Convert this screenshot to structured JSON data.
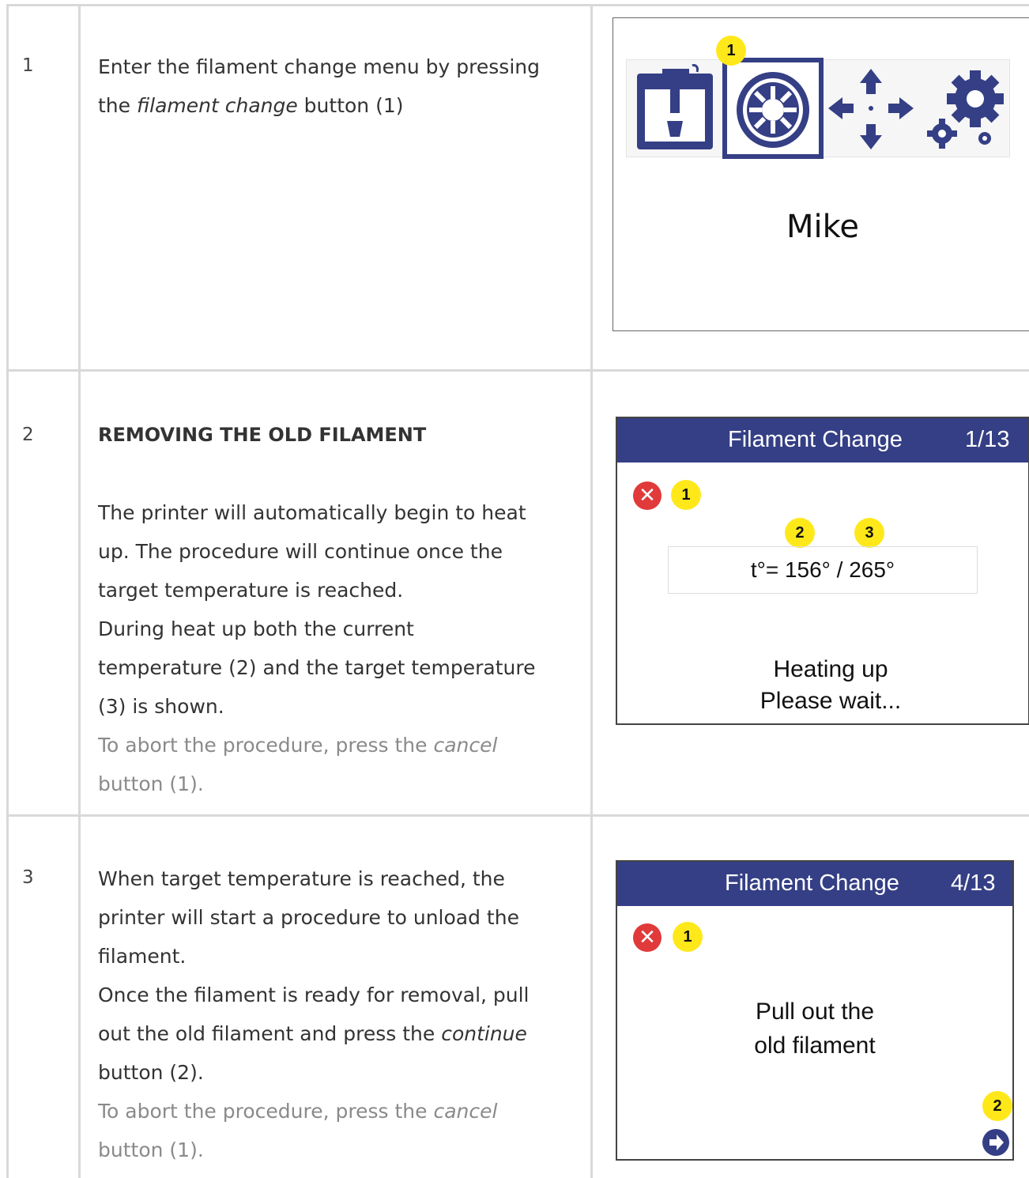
{
  "steps": [
    {
      "number": "1",
      "line1": "Enter the filament change menu by pressing",
      "line2_pre": "the ",
      "line2_em": "filament change",
      "line2_post": " button (1)"
    },
    {
      "number": "2",
      "heading": "REMOVING THE OLD FILAMENT",
      "p1_l1": "The printer will automatically begin to heat",
      "p1_l2": "up. The procedure will continue once the",
      "p1_l3": "target temperature is reached.",
      "p2_l1": "During heat up both the current",
      "p2_l2": "temperature (2) and the target temperature",
      "p2_l3": "(3) is shown.",
      "abort_pre": "To abort the procedure, press the ",
      "abort_em": "cancel",
      "abort_l2": "button (1)."
    },
    {
      "number": "3",
      "l1": "When target temperature is reached, the",
      "l2": "printer will start a procedure to unload the",
      "l3": "filament.",
      "l4": "Once the filament is ready for removal, pull",
      "l5_pre": "out the old filament and press the ",
      "l5_em": "continue",
      "l6": "button (2).",
      "abort_pre": "To abort the procedure, press the ",
      "abort_em": "cancel",
      "abort_l2": "button (1)."
    }
  ],
  "screen1": {
    "badge": "1",
    "name": "Mike",
    "icons": [
      "printer-icon",
      "filament-spool-icon",
      "move-arrows-icon",
      "settings-gears-icon"
    ]
  },
  "screen2": {
    "title": "Filament Change",
    "page": "1/13",
    "badges": [
      "1",
      "2",
      "3"
    ],
    "temperature": "t°= 156° / 265°",
    "status_l1": "Heating up",
    "status_l2": "Please wait..."
  },
  "screen3": {
    "title": "Filament Change",
    "page": "4/13",
    "badges": [
      "1",
      "2"
    ],
    "msg_l1": "Pull out the",
    "msg_l2": "old filament"
  },
  "colors": {
    "header": "#353f85",
    "badge": "#ffe81a",
    "cancel": "#e03a3a",
    "icon": "#353f85"
  }
}
